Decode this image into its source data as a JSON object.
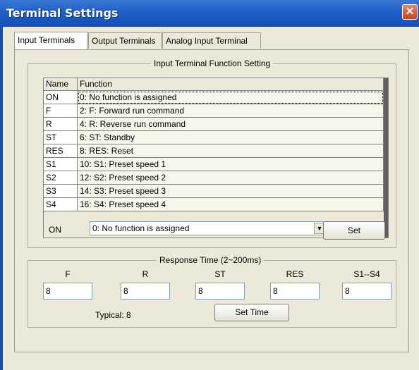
{
  "window": {
    "title": "Terminal Settings",
    "close_glyph": "✕"
  },
  "tabs": [
    {
      "label": "Input Terminals",
      "active": true
    },
    {
      "label": "Output Terminals",
      "active": false
    },
    {
      "label": "Analog Input Terminal",
      "active": false
    }
  ],
  "function_group": {
    "title": "Input Terminal Function Setting",
    "columns": [
      "Name",
      "Function"
    ],
    "rows": [
      {
        "name": "ON",
        "function": "0: No function is assigned"
      },
      {
        "name": "F",
        "function": "2: F: Forward run command"
      },
      {
        "name": "R",
        "function": "4: R: Reverse run command"
      },
      {
        "name": "ST",
        "function": "6: ST: Standby"
      },
      {
        "name": "RES",
        "function": "8: RES: Reset"
      },
      {
        "name": "S1",
        "function": "10: S1: Preset speed 1"
      },
      {
        "name": "S2",
        "function": "12: S2: Preset speed 2"
      },
      {
        "name": "S3",
        "function": "14: S3: Preset speed 3"
      },
      {
        "name": "S4",
        "function": "16: S4: Preset speed 4"
      }
    ],
    "selected_terminal": "ON",
    "selected_function": "0: No function is assigned",
    "set_button": "Set"
  },
  "response_group": {
    "title": "Response Time (2~200ms)",
    "fields": [
      {
        "label": "F",
        "value": "8"
      },
      {
        "label": "R",
        "value": "8"
      },
      {
        "label": "ST",
        "value": "8"
      },
      {
        "label": "RES",
        "value": "8"
      },
      {
        "label": "S1--S4",
        "value": "8"
      }
    ],
    "typical": "Typical: 8",
    "set_time_button": "Set Time"
  },
  "colors": {
    "titlebar": "#0e4fb8",
    "face": "#ece9d8",
    "row_fill": "#f3f8e8"
  },
  "icons": {
    "close": "close-icon",
    "dropdown": "chevron-down-icon"
  }
}
